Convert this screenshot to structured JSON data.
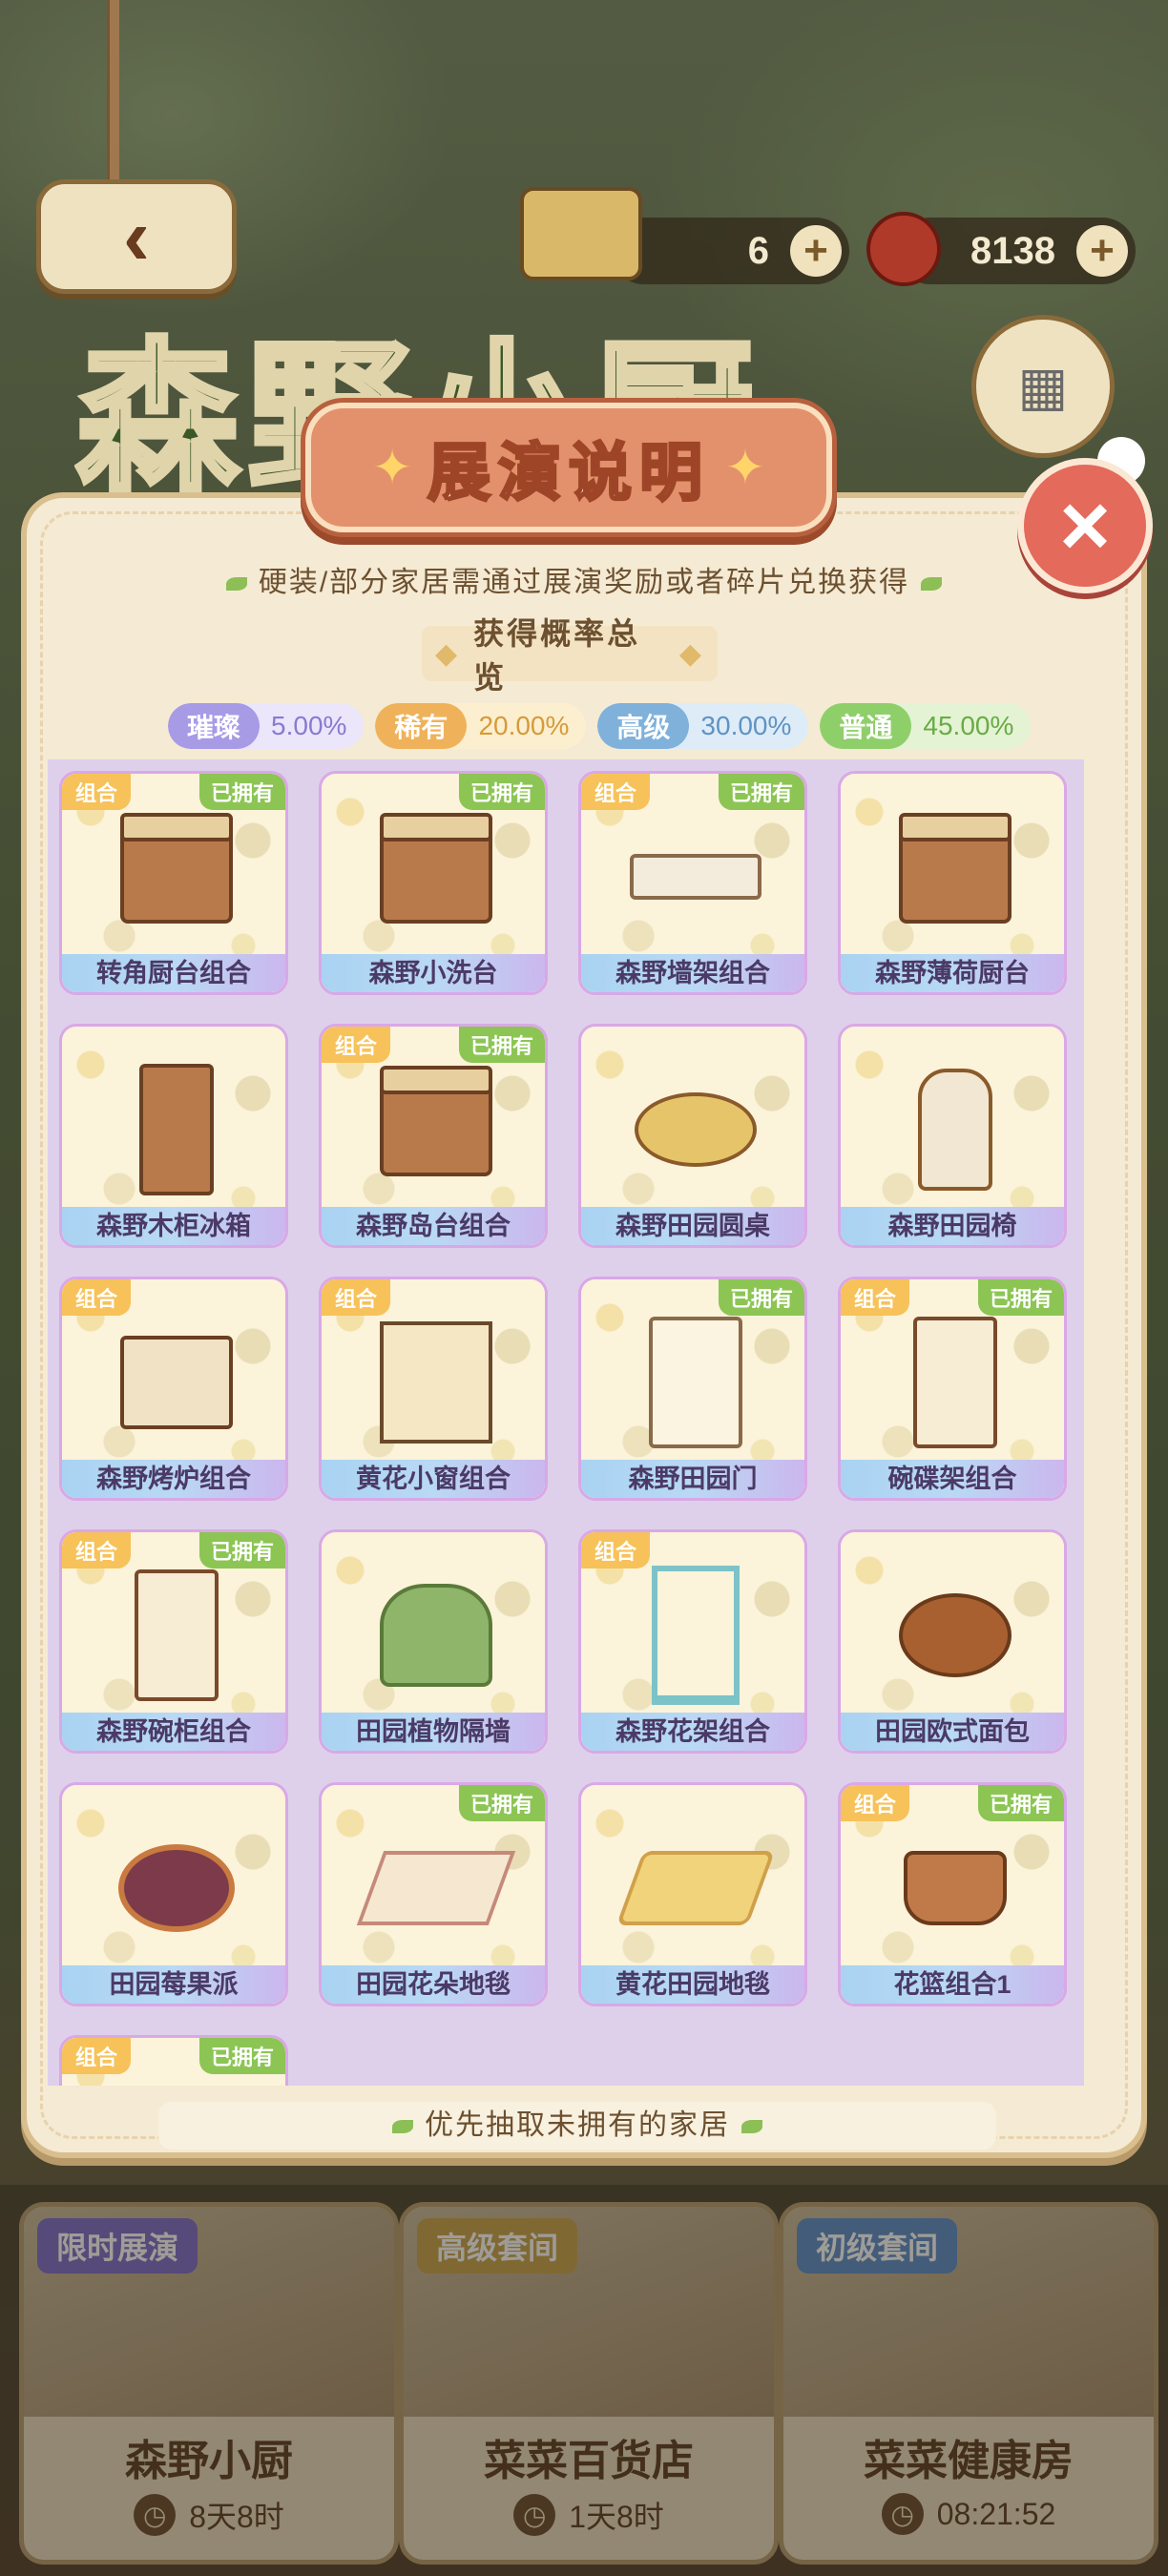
{
  "background": {
    "resources": [
      {
        "name": "furniture-ticket",
        "value": "6"
      },
      {
        "name": "berry",
        "value": "8138"
      }
    ],
    "pool_title": "森野小厨",
    "pools": [
      {
        "tag": "限时展演",
        "tag_color": "#7a6bc8",
        "name": "森野小厨",
        "timer": "8天8时"
      },
      {
        "tag": "高级套间",
        "tag_color": "#c9a04a",
        "name": "菜菜百货店",
        "timer": "1天8时"
      },
      {
        "tag": "初级套间",
        "tag_color": "#5a8ac8",
        "name": "菜菜健康房",
        "timer": "08:21:52"
      }
    ]
  },
  "modal": {
    "title": "展演说明",
    "description": "硬装/部分家居需通过展演奖励或者碎片兑换获得",
    "overview_title": "获得概率总览",
    "rates": [
      {
        "label": "璀璨",
        "value": "5.00%",
        "color": "#a79be6",
        "bg": "#ece6fb",
        "text_color": "#8a7ad0"
      },
      {
        "label": "稀有",
        "value": "20.00%",
        "color": "#efb25a",
        "bg": "#fbefcf",
        "text_color": "#d69a3a"
      },
      {
        "label": "高级",
        "value": "30.00%",
        "color": "#7fb1db",
        "bg": "#deecf8",
        "text_color": "#5f93c3"
      },
      {
        "label": "普通",
        "value": "45.00%",
        "color": "#8fcf6a",
        "bg": "#e4f3d4",
        "text_color": "#6aab45"
      }
    ],
    "badges": {
      "combo": "组合",
      "owned": "已拥有"
    },
    "items": [
      {
        "name": "转角厨台组合",
        "combo": true,
        "owned": true,
        "shape": "box"
      },
      {
        "name": "森野小洗台",
        "combo": false,
        "owned": true,
        "shape": "box"
      },
      {
        "name": "森野墙架组合",
        "combo": true,
        "owned": true,
        "shape": "shelf"
      },
      {
        "name": "森野薄荷厨台",
        "combo": false,
        "owned": false,
        "shape": "box"
      },
      {
        "name": "森野木柜冰箱",
        "combo": false,
        "owned": false,
        "shape": "tall"
      },
      {
        "name": "森野岛台组合",
        "combo": true,
        "owned": true,
        "shape": "box"
      },
      {
        "name": "森野田园圆桌",
        "combo": false,
        "owned": false,
        "shape": "table"
      },
      {
        "name": "森野田园椅",
        "combo": false,
        "owned": false,
        "shape": "chair"
      },
      {
        "name": "森野烤炉组合",
        "combo": true,
        "owned": false,
        "shape": "stove"
      },
      {
        "name": "黄花小窗组合",
        "combo": true,
        "owned": false,
        "shape": "window"
      },
      {
        "name": "森野田园门",
        "combo": false,
        "owned": true,
        "shape": "door"
      },
      {
        "name": "碗碟架组合",
        "combo": true,
        "owned": true,
        "shape": "cabinet"
      },
      {
        "name": "森野碗柜组合",
        "combo": true,
        "owned": true,
        "shape": "cabinet"
      },
      {
        "name": "田园植物隔墙",
        "combo": false,
        "owned": false,
        "shape": "plant"
      },
      {
        "name": "森野花架组合",
        "combo": true,
        "owned": false,
        "shape": "rack"
      },
      {
        "name": "田园欧式面包",
        "combo": false,
        "owned": false,
        "shape": "bread"
      },
      {
        "name": "田园莓果派",
        "combo": false,
        "owned": false,
        "shape": "pie"
      },
      {
        "name": "田园花朵地毯",
        "combo": false,
        "owned": true,
        "shape": "rug"
      },
      {
        "name": "黄花田园地毯",
        "combo": false,
        "owned": false,
        "shape": "rug2"
      },
      {
        "name": "花篮组合1",
        "combo": true,
        "owned": true,
        "shape": "basket"
      },
      {
        "name": "",
        "combo": true,
        "owned": true,
        "shape": "basket",
        "partial": true
      }
    ],
    "priority_note": "优先抽取未拥有的家居"
  }
}
